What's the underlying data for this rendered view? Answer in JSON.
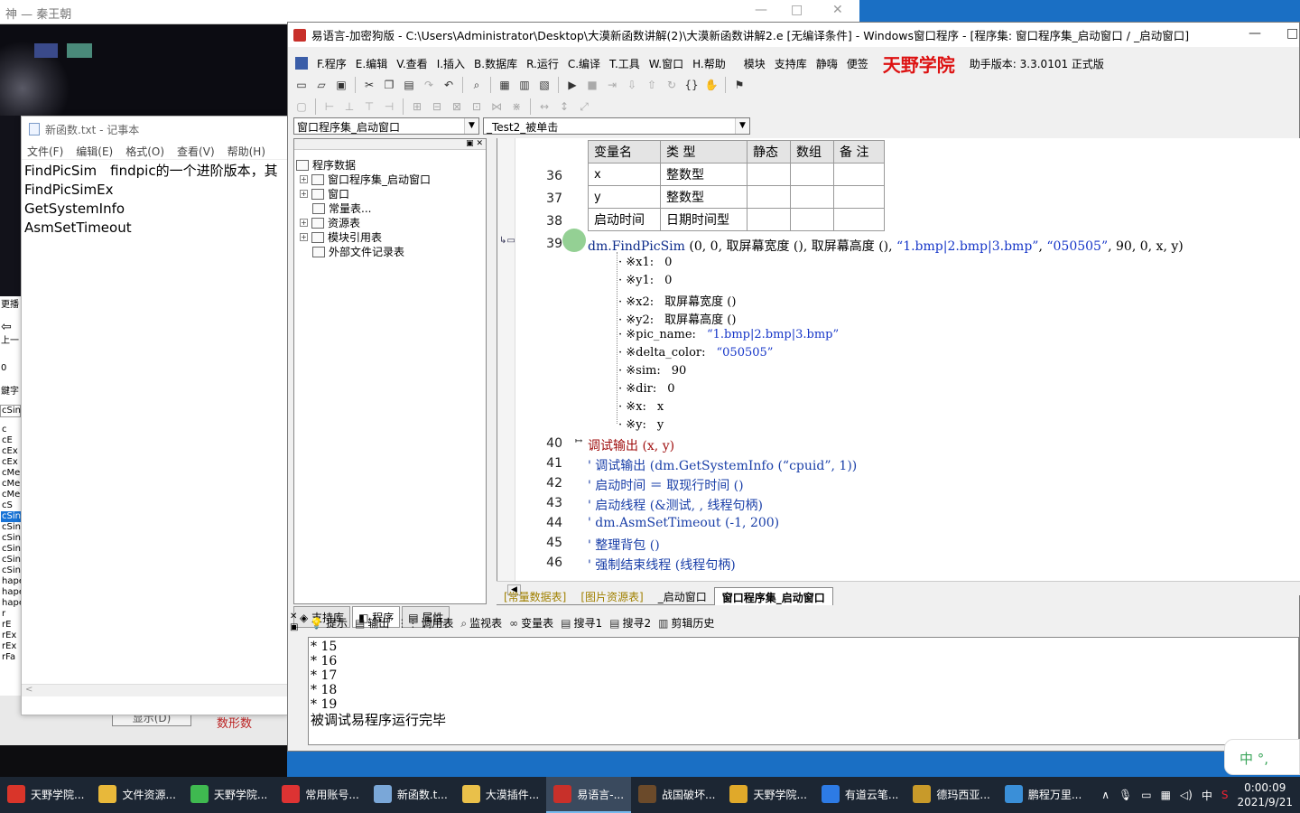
{
  "bg_window": {
    "title": "神 — 秦王朝",
    "controls": [
      "—",
      "□",
      "✕"
    ]
  },
  "left_strip": {
    "top_texts": [
      "更播",
      "⇦",
      "上一",
      "0",
      "鍵字",
      "cSin"
    ],
    "items": [
      "c",
      "cE",
      "cEx",
      "cEx",
      "cMer",
      "cMer",
      "cMer",
      "cS",
      "cSin",
      "cSin",
      "cSin",
      "cSin",
      "cSin",
      "cSin",
      "hape",
      "hape",
      "hape",
      "r",
      "rE",
      "rEx",
      "rEx",
      "rFa"
    ],
    "selected_index": 8
  },
  "behind_buttons": {
    "b1": "显示(D)",
    "b2": "数形数"
  },
  "notepad": {
    "title": "新函数.txt - 记事本",
    "menu": [
      "文件(F)",
      "编辑(E)",
      "格式(O)",
      "查看(V)",
      "帮助(H)"
    ],
    "lines": [
      "FindPicSim　findpic的一个进阶版本，其",
      "FindPicSimEx",
      "GetSystemInfo",
      "AsmSetTimeout"
    ],
    "scroll_arrow": "<"
  },
  "ide": {
    "title": "易语言-加密狗版 - C:\\Users\\Administrator\\Desktop\\大漠新函数讲解(2)\\大漠新函数讲解2.e [无编译条件] - Windows窗口程序 - [程序集: 窗口程序集_启动窗口 / _启动窗口]",
    "title_controls": [
      "—",
      "□"
    ],
    "menu": [
      "F.程序",
      "E.编辑",
      "V.查看",
      "I.插入",
      "B.数据库",
      "R.运行",
      "C.编译",
      "T.工具",
      "W.窗口",
      "H.帮助",
      "模块",
      "支持库",
      "静嗨",
      "便签"
    ],
    "brand": "天野学院",
    "version_label": "助手版本: 3.3.0101 正式版",
    "combo_left": "窗口程序集_启动窗口",
    "combo_right": "_Test2_被单击",
    "tree": {
      "root": "程序数据",
      "nodes": [
        "窗口程序集_启动窗口",
        "窗口",
        "常量表...",
        "资源表",
        "模块引用表",
        "外部文件记录表"
      ]
    },
    "left_tabs": [
      "支持库",
      "程序",
      "属性"
    ],
    "var_table": {
      "headers": [
        "变量名",
        "类 型",
        "静态",
        "数组",
        "备 注"
      ],
      "rows": [
        {
          "ln": "36",
          "name": "x",
          "type": "整数型"
        },
        {
          "ln": "37",
          "name": "y",
          "type": "整数型"
        },
        {
          "ln": "38",
          "name": "启动时间",
          "type": "日期时间型"
        }
      ]
    },
    "code": {
      "l39": {
        "ln": "39",
        "prefix": "dm.",
        "fn": "FindPicSim",
        "args": " (0, 0, 取屏幕宽度 (), 取屏幕高度 (), ",
        "s1": "“1.bmp|2.bmp|3.bmp”",
        "mid": ", ",
        "s2": "“050505”",
        "tail": ", 90, 0, x, y)"
      },
      "params": [
        {
          "k": "※x1:",
          "v": "0"
        },
        {
          "k": "※y1:",
          "v": "0"
        },
        {
          "k": "※x2:",
          "v": "取屏幕宽度 ()"
        },
        {
          "k": "※y2:",
          "v": "取屏幕高度 ()"
        },
        {
          "k": "※pic_name:",
          "v": "“1.bmp|2.bmp|3.bmp”"
        },
        {
          "k": "※delta_color:",
          "v": "“050505”"
        },
        {
          "k": "※sim:",
          "v": "90"
        },
        {
          "k": "※dir:",
          "v": "0"
        },
        {
          "k": "※x:",
          "v": "x"
        },
        {
          "k": "※y:",
          "v": "y"
        }
      ],
      "lines": [
        {
          "ln": "40",
          "text": "调试输出 (x, y)",
          "cls": "red",
          "marker": "↦"
        },
        {
          "ln": "41",
          "text": "' 调试输出 (dm.GetSystemInfo (“cpuid”, 1))",
          "cls": "cmt"
        },
        {
          "ln": "42",
          "text": "' 启动时间 ＝ 取现行时间 ()",
          "cls": "cmt"
        },
        {
          "ln": "43",
          "text": "' 启动线程 (&测试, , 线程句柄)",
          "cls": "cmt"
        },
        {
          "ln": "44",
          "text": "' dm.AsmSetTimeout (-1, 200)",
          "cls": "cmt"
        },
        {
          "ln": "45",
          "text": "' 整理背包 ()",
          "cls": "cmt"
        },
        {
          "ln": "46",
          "text": "' 强制结束线程 (线程句柄)",
          "cls": "cmt"
        }
      ]
    },
    "right_tabs": [
      "[常量数据表]",
      "[图片资源表]",
      "_启动窗口",
      "窗口程序集_启动窗口"
    ],
    "bottom_tabs": [
      "提示",
      "输出",
      "调用表",
      "监视表",
      "变量表",
      "搜寻1",
      "搜寻2",
      "剪辑历史"
    ],
    "output_lines": [
      "* 15",
      "* 16",
      "* 17",
      "* 18",
      "* 19",
      "被调试易程序运行完毕"
    ]
  },
  "ime": {
    "text": "中 °,"
  },
  "taskbar": {
    "tasks": [
      {
        "label": "天野学院...",
        "color": "#d9352a"
      },
      {
        "label": "文件资源...",
        "color": "#e8b83a"
      },
      {
        "label": "天野学院...",
        "color": "#3fb950"
      },
      {
        "label": "常用账号...",
        "color": "#d33"
      },
      {
        "label": "新函数.t...",
        "color": "#7aa7d8"
      },
      {
        "label": "大漠插件...",
        "color": "#e9c04a"
      },
      {
        "label": "易语言-...",
        "color": "#c8302a",
        "active": true
      },
      {
        "label": "战国破坏...",
        "color": "#6b4a2a"
      },
      {
        "label": "天野学院...",
        "color": "#e0a92a"
      },
      {
        "label": "有道云笔...",
        "color": "#2d7be5"
      },
      {
        "label": "德玛西亚...",
        "color": "#c89a2a"
      },
      {
        "label": "鹏程万里...",
        "color": "#3a8fd8"
      }
    ],
    "tray": {
      "ime": "中",
      "time": "0:00:09",
      "date": "2021/9/21"
    }
  }
}
